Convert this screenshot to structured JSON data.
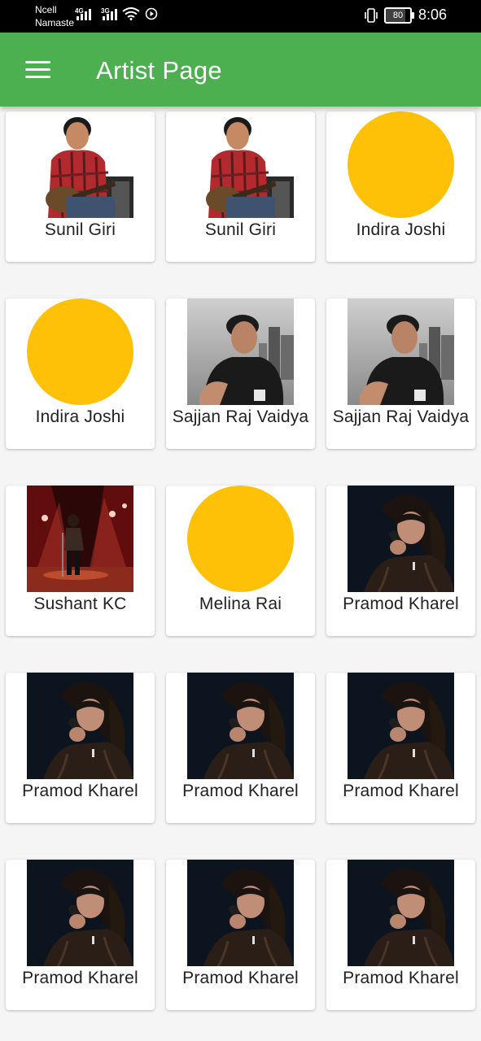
{
  "status_bar": {
    "carrier_line1": "Ncell",
    "carrier_line2": "Namaste",
    "signal1_label": "4G",
    "signal2_label": "3G",
    "battery": "80",
    "battery_level": 0.8,
    "time": "8:06"
  },
  "app_bar": {
    "title": "Artist Page"
  },
  "placeholder_color": "#ffc107",
  "artists": [
    {
      "name": "Sunil Giri",
      "photo": "guitarist-photo"
    },
    {
      "name": "Sunil Giri",
      "photo": "guitarist-photo"
    },
    {
      "name": "Indira Joshi",
      "photo": "placeholder-circle"
    },
    {
      "name": "Indira Joshi",
      "photo": "placeholder-circle"
    },
    {
      "name": "Sajjan Raj Vaidya",
      "photo": "city-portrait-photo"
    },
    {
      "name": "Sajjan Raj Vaidya",
      "photo": "city-portrait-photo"
    },
    {
      "name": "Sushant KC",
      "photo": "stage-photo"
    },
    {
      "name": "Melina Rai",
      "photo": "placeholder-circle"
    },
    {
      "name": "Pramod Kharel",
      "photo": "singer-mic-photo"
    },
    {
      "name": "Pramod Kharel",
      "photo": "singer-mic-photo"
    },
    {
      "name": "Pramod Kharel",
      "photo": "singer-mic-photo"
    },
    {
      "name": "Pramod Kharel",
      "photo": "singer-mic-photo"
    },
    {
      "name": "Pramod Kharel",
      "photo": "singer-mic-photo"
    },
    {
      "name": "Pramod Kharel",
      "photo": "singer-mic-photo"
    },
    {
      "name": "Pramod Kharel",
      "photo": "singer-mic-photo"
    }
  ]
}
